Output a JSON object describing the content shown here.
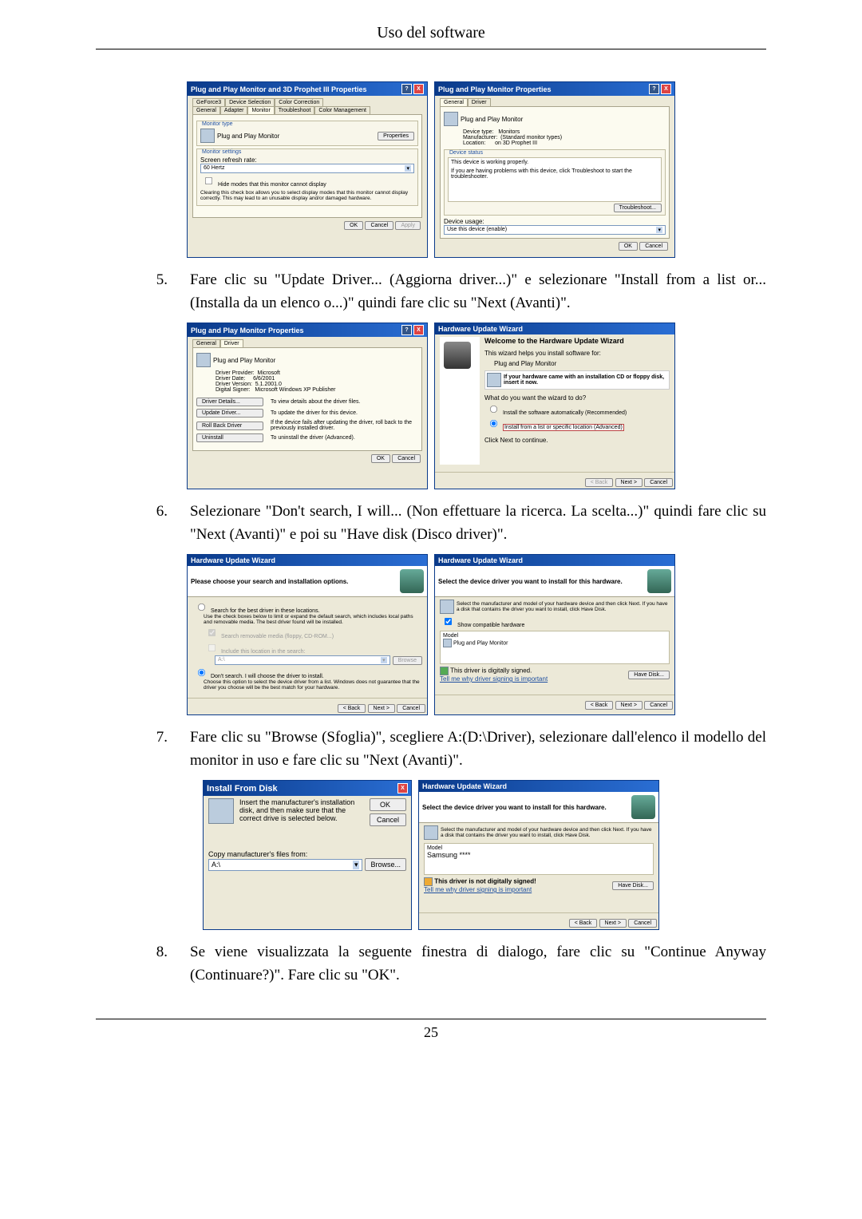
{
  "header": "Uso del software",
  "steps": {
    "s5": {
      "num": "5.",
      "text": "Fare clic su \"Update Driver... (Aggiorna driver...)\" e selezionare \"Install from a list or... (Installa da un elenco o...)\" quindi fare clic su \"Next (Avanti)\"."
    },
    "s6": {
      "num": "6.",
      "text": "Selezionare \"Don't search, I will... (Non effettuare la ricerca. La scelta...)\" quindi fare clic su \"Next (Avanti)\" e poi su \"Have disk (Disco driver)\"."
    },
    "s7": {
      "num": "7.",
      "text": "Fare clic su \"Browse (Sfoglia)\", scegliere A:(D:\\Driver), selezionare dall'elenco il modello del monitor in uso e fare clic su \"Next (Avanti)\"."
    },
    "s8": {
      "num": "8.",
      "text": "Se viene visualizzata la seguente finestra di dialogo, fare clic su \"Continue Anyway (Continuare?)\". Fare clic su \"OK\"."
    }
  },
  "win1a": {
    "title": "Plug and Play Monitor and 3D Prophet III Properties",
    "tabs": [
      "GeForce3",
      "Device Selection",
      "Color Correction"
    ],
    "tabs2": [
      "General",
      "Adapter",
      "Monitor",
      "Troubleshoot",
      "Color Management"
    ],
    "monType": "Monitor type",
    "monName": "Plug and Play Monitor",
    "propBtn": "Properties",
    "settings": "Monitor settings",
    "refresh": "Screen refresh rate:",
    "hz": "60 Hertz",
    "hide": "Hide modes that this monitor cannot display",
    "note": "Clearing this check box allows you to select display modes that this monitor cannot display correctly. This may lead to an unusable display and/or damaged hardware.",
    "ok": "OK",
    "cancel": "Cancel",
    "apply": "Apply"
  },
  "win1b": {
    "title": "Plug and Play Monitor Properties",
    "tabs": [
      "General",
      "Driver"
    ],
    "name": "Plug and Play Monitor",
    "dtLbl": "Device type:",
    "dt": "Monitors",
    "mfLbl": "Manufacturer:",
    "mf": "(Standard monitor types)",
    "locLbl": "Location:",
    "loc": "on 3D Prophet III",
    "statusTitle": "Device status",
    "status1": "This device is working properly.",
    "status2": "If you are having problems with this device, click Troubleshoot to start the troubleshooter.",
    "trouble": "Troubleshoot...",
    "usageLbl": "Device usage:",
    "usage": "Use this device (enable)",
    "ok": "OK",
    "cancel": "Cancel"
  },
  "win2a": {
    "title": "Plug and Play Monitor Properties",
    "tabs": [
      "General",
      "Driver"
    ],
    "name": "Plug and Play Monitor",
    "provLbl": "Driver Provider:",
    "prov": "Microsoft",
    "dateLbl": "Driver Date:",
    "date": "6/6/2001",
    "verLbl": "Driver Version:",
    "ver": "5.1.2001.0",
    "sigLbl": "Digital Signer:",
    "sig": "Microsoft Windows XP Publisher",
    "btns": {
      "details": "Driver Details...",
      "detailsTxt": "To view details about the driver files.",
      "update": "Update Driver...",
      "updateTxt": "To update the driver for this device.",
      "roll": "Roll Back Driver",
      "rollTxt": "If the device fails after updating the driver, roll back to the previously installed driver.",
      "uninst": "Uninstall",
      "uninstTxt": "To uninstall the driver (Advanced)."
    },
    "ok": "OK",
    "cancel": "Cancel"
  },
  "win2b": {
    "title": "Hardware Update Wizard",
    "welcome": "Welcome to the Hardware Update Wizard",
    "helps": "This wizard helps you install software for:",
    "dev": "Plug and Play Monitor",
    "cdTxt": "If your hardware came with an installation CD or floppy disk, insert it now.",
    "q": "What do you want the wizard to do?",
    "r1": "Install the software automatically (Recommended)",
    "r2": "Install from a list or specific location (Advanced)",
    "cont": "Click Next to continue.",
    "back": "< Back",
    "next": "Next >",
    "cancel": "Cancel"
  },
  "win3a": {
    "title": "Hardware Update Wizard",
    "head": "Please choose your search and installation options.",
    "r1": "Search for the best driver in these locations.",
    "r1t": "Use the check boxes below to limit or expand the default search, which includes local paths and removable media. The best driver found will be installed.",
    "c1": "Search removable media (floppy, CD-ROM...)",
    "c2": "Include this location in the search:",
    "path": "A:\\",
    "browse": "Browse",
    "r2": "Don't search. I will choose the driver to install.",
    "r2t": "Choose this option to select the device driver from a list. Windows does not guarantee that the driver you choose will be the best match for your hardware.",
    "back": "< Back",
    "next": "Next >",
    "cancel": "Cancel"
  },
  "win3b": {
    "title": "Hardware Update Wizard",
    "head": "Select the device driver you want to install for this hardware.",
    "sel": "Select the manufacturer and model of your hardware device and then click Next. If you have a disk that contains the driver you want to install, click Have Disk.",
    "show": "Show compatible hardware",
    "model": "Model",
    "m1": "Plug and Play Monitor",
    "signed": "This driver is digitally signed.",
    "tell": "Tell me why driver signing is important",
    "have": "Have Disk...",
    "back": "< Back",
    "next": "Next >",
    "cancel": "Cancel"
  },
  "win4a": {
    "title": "Install From Disk",
    "txt": "Insert the manufacturer's installation disk, and then make sure that the correct drive is selected below.",
    "copy": "Copy manufacturer's files from:",
    "path": "A:\\",
    "ok": "OK",
    "cancel": "Cancel",
    "browse": "Browse..."
  },
  "win4b": {
    "title": "Hardware Update Wizard",
    "head": "Select the device driver you want to install for this hardware.",
    "sel": "Select the manufacturer and model of your hardware device and then click Next. If you have a disk that contains the driver you want to install, click Have Disk.",
    "model": "Model",
    "m1": "Samsung ****",
    "notsigned": "This driver is not digitally signed!",
    "tell": "Tell me why driver signing is important",
    "have": "Have Disk...",
    "back": "< Back",
    "next": "Next >",
    "cancel": "Cancel"
  },
  "pagenum": "25"
}
